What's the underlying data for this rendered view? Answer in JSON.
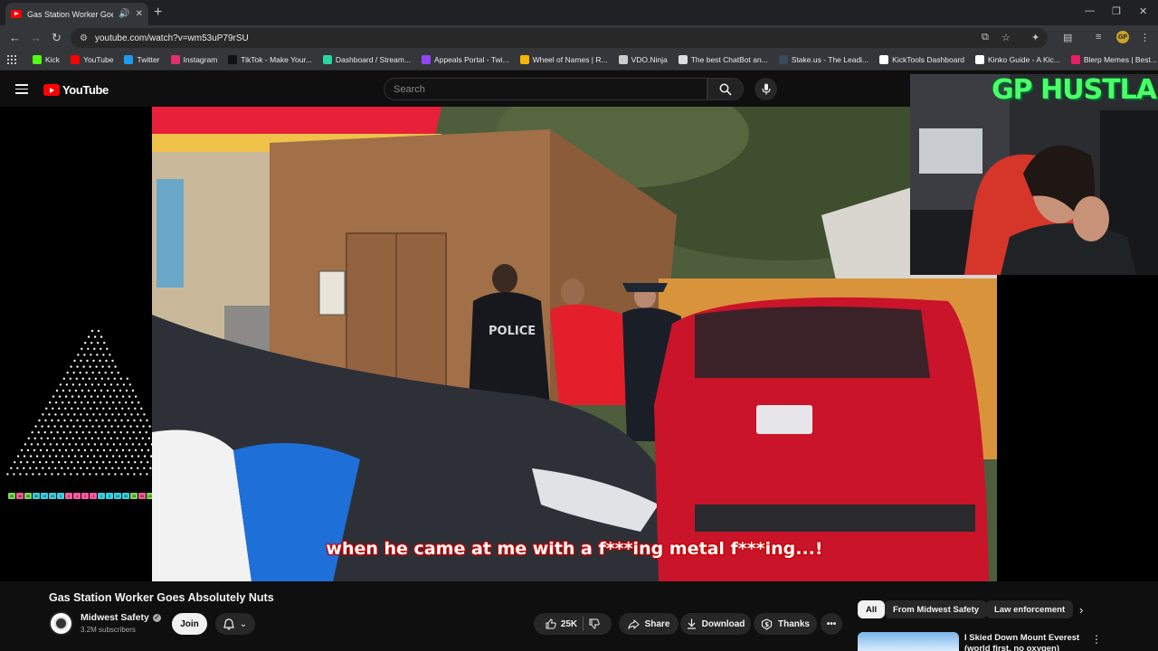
{
  "browser": {
    "tab_title": "Gas Station Worker Goes Al",
    "url": "youtube.com/watch?v=wm53uP79rSU",
    "bookmarks": [
      {
        "label": "Kick",
        "color": "#53fc18"
      },
      {
        "label": "YouTube",
        "color": "#ff0000"
      },
      {
        "label": "Twitter",
        "color": "#1d9bf0"
      },
      {
        "label": "Instagram",
        "color": "#e1306c"
      },
      {
        "label": "TikTok - Make Your...",
        "color": "#111111"
      },
      {
        "label": "Dashboard / Stream...",
        "color": "#2bd4a4"
      },
      {
        "label": "Appeals Portal - Twi...",
        "color": "#9146ff"
      },
      {
        "label": "Wheel of Names | R...",
        "color": "#f4b400"
      },
      {
        "label": "VDO.Ninja",
        "color": "#cccccc"
      },
      {
        "label": "The best ChatBot an...",
        "color": "#dddddd"
      },
      {
        "label": "Stake.us - The Leadi...",
        "color": "#3a4a5a"
      },
      {
        "label": "KickTools Dashboard",
        "color": "#ffffff"
      },
      {
        "label": "Kinko Guide - A Kic...",
        "color": "#ffffff"
      },
      {
        "label": "Blerp Memes | Best...",
        "color": "#e91e63"
      }
    ]
  },
  "youtube": {
    "logo_text": "YouTube",
    "search_placeholder": "Search"
  },
  "video": {
    "subtitle": "when he came at me with a f***ing metal f***ing...!",
    "patrol_text": "POLICE"
  },
  "webcam": {
    "overlay_title": "GP HUSTLA"
  },
  "counter_strip": [
    "20",
    "30",
    "35",
    "30",
    "10",
    "10",
    "1",
    "1",
    "-1",
    "2",
    "-1",
    "1",
    "5",
    "10",
    "30",
    "35",
    "30",
    "100"
  ],
  "details": {
    "title": "Gas Station Worker Goes Absolutely Nuts",
    "channel_name": "Midwest Safety",
    "subscribers": "3.2M subscribers",
    "join_label": "Join",
    "like_count": "25K",
    "share_label": "Share",
    "download_label": "Download",
    "thanks_label": "Thanks"
  },
  "sidebar": {
    "chips": [
      "All",
      "From Midwest Safety",
      "Law enforcement"
    ],
    "rec_title": "I Skied Down Mount Everest (world first, no oxygen)"
  },
  "colors": {
    "accent": "#ff0000",
    "background": "#0f0f0f",
    "webcam_title": "#4dff66"
  }
}
